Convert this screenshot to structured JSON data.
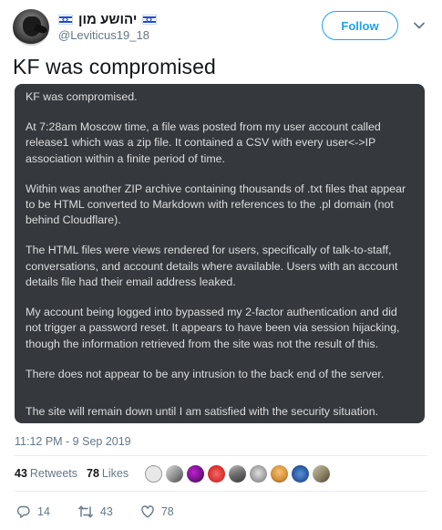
{
  "user": {
    "display_name": "יהושע מון",
    "handle": "@Leviticus19_18",
    "follow_label": "Follow"
  },
  "tweet": {
    "text": "KF was compromised",
    "timestamp": "11:12 PM - 9 Sep 2019"
  },
  "image_text": {
    "paragraphs": [
      "KF was compromised.",
      "At 7:28am Moscow time, a file was posted from my user account called release1 which was a zip file. It contained a CSV with every user<->IP association within a finite period of time.",
      "Within was another ZIP archive containing thousands of .txt files that appear to be HTML converted to Markdown with references to the .pl domain (not behind Cloudflare).",
      "The HTML files were views rendered for users, specifically of talk-to-staff, conversations, and account details where available. Users with an account details file had their email address leaked.",
      "My account being logged into bypassed my 2-factor authentication and did not trigger a password reset. It appears to have been via session hijacking, though the information retrieved from the site was not the result of this.",
      "There does not appear to be any intrusion to the back end of the server.",
      "The site will remain down until I am satisfied with the security situation."
    ]
  },
  "stats": {
    "retweets_count": "43",
    "retweets_label": "Retweets",
    "likes_count": "78",
    "likes_label": "Likes"
  },
  "actions": {
    "reply_count": "14",
    "retweet_count": "43",
    "like_count": "78"
  },
  "colors": {
    "accent": "#1da1f2",
    "image_background": "#35393e",
    "image_text": "#dcddde",
    "muted_text": "#657786"
  },
  "icons": {
    "reply": "reply-icon",
    "retweet": "retweet-icon",
    "like": "heart-icon",
    "more": "chevron-down-icon"
  }
}
